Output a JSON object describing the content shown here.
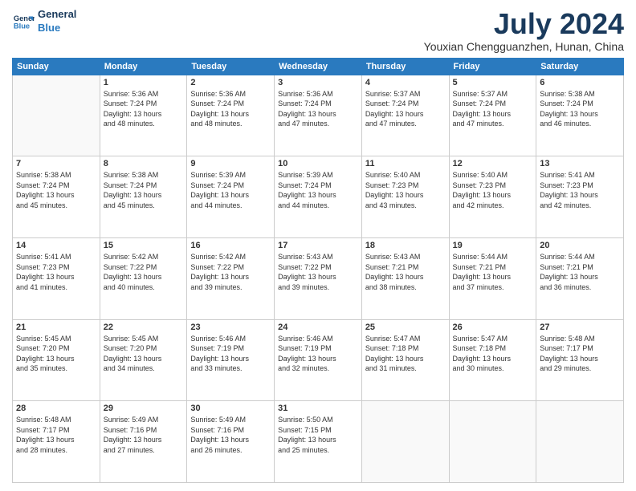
{
  "header": {
    "logo_line1": "General",
    "logo_line2": "Blue",
    "title": "July 2024",
    "subtitle": "Youxian Chengguanzhen, Hunan, China"
  },
  "days_of_week": [
    "Sunday",
    "Monday",
    "Tuesday",
    "Wednesday",
    "Thursday",
    "Friday",
    "Saturday"
  ],
  "weeks": [
    [
      {
        "day": "",
        "info": ""
      },
      {
        "day": "1",
        "info": "Sunrise: 5:36 AM\nSunset: 7:24 PM\nDaylight: 13 hours\nand 48 minutes."
      },
      {
        "day": "2",
        "info": "Sunrise: 5:36 AM\nSunset: 7:24 PM\nDaylight: 13 hours\nand 48 minutes."
      },
      {
        "day": "3",
        "info": "Sunrise: 5:36 AM\nSunset: 7:24 PM\nDaylight: 13 hours\nand 47 minutes."
      },
      {
        "day": "4",
        "info": "Sunrise: 5:37 AM\nSunset: 7:24 PM\nDaylight: 13 hours\nand 47 minutes."
      },
      {
        "day": "5",
        "info": "Sunrise: 5:37 AM\nSunset: 7:24 PM\nDaylight: 13 hours\nand 47 minutes."
      },
      {
        "day": "6",
        "info": "Sunrise: 5:38 AM\nSunset: 7:24 PM\nDaylight: 13 hours\nand 46 minutes."
      }
    ],
    [
      {
        "day": "7",
        "info": "Sunrise: 5:38 AM\nSunset: 7:24 PM\nDaylight: 13 hours\nand 45 minutes."
      },
      {
        "day": "8",
        "info": "Sunrise: 5:38 AM\nSunset: 7:24 PM\nDaylight: 13 hours\nand 45 minutes."
      },
      {
        "day": "9",
        "info": "Sunrise: 5:39 AM\nSunset: 7:24 PM\nDaylight: 13 hours\nand 44 minutes."
      },
      {
        "day": "10",
        "info": "Sunrise: 5:39 AM\nSunset: 7:24 PM\nDaylight: 13 hours\nand 44 minutes."
      },
      {
        "day": "11",
        "info": "Sunrise: 5:40 AM\nSunset: 7:23 PM\nDaylight: 13 hours\nand 43 minutes."
      },
      {
        "day": "12",
        "info": "Sunrise: 5:40 AM\nSunset: 7:23 PM\nDaylight: 13 hours\nand 42 minutes."
      },
      {
        "day": "13",
        "info": "Sunrise: 5:41 AM\nSunset: 7:23 PM\nDaylight: 13 hours\nand 42 minutes."
      }
    ],
    [
      {
        "day": "14",
        "info": "Sunrise: 5:41 AM\nSunset: 7:23 PM\nDaylight: 13 hours\nand 41 minutes."
      },
      {
        "day": "15",
        "info": "Sunrise: 5:42 AM\nSunset: 7:22 PM\nDaylight: 13 hours\nand 40 minutes."
      },
      {
        "day": "16",
        "info": "Sunrise: 5:42 AM\nSunset: 7:22 PM\nDaylight: 13 hours\nand 39 minutes."
      },
      {
        "day": "17",
        "info": "Sunrise: 5:43 AM\nSunset: 7:22 PM\nDaylight: 13 hours\nand 39 minutes."
      },
      {
        "day": "18",
        "info": "Sunrise: 5:43 AM\nSunset: 7:21 PM\nDaylight: 13 hours\nand 38 minutes."
      },
      {
        "day": "19",
        "info": "Sunrise: 5:44 AM\nSunset: 7:21 PM\nDaylight: 13 hours\nand 37 minutes."
      },
      {
        "day": "20",
        "info": "Sunrise: 5:44 AM\nSunset: 7:21 PM\nDaylight: 13 hours\nand 36 minutes."
      }
    ],
    [
      {
        "day": "21",
        "info": "Sunrise: 5:45 AM\nSunset: 7:20 PM\nDaylight: 13 hours\nand 35 minutes."
      },
      {
        "day": "22",
        "info": "Sunrise: 5:45 AM\nSunset: 7:20 PM\nDaylight: 13 hours\nand 34 minutes."
      },
      {
        "day": "23",
        "info": "Sunrise: 5:46 AM\nSunset: 7:19 PM\nDaylight: 13 hours\nand 33 minutes."
      },
      {
        "day": "24",
        "info": "Sunrise: 5:46 AM\nSunset: 7:19 PM\nDaylight: 13 hours\nand 32 minutes."
      },
      {
        "day": "25",
        "info": "Sunrise: 5:47 AM\nSunset: 7:18 PM\nDaylight: 13 hours\nand 31 minutes."
      },
      {
        "day": "26",
        "info": "Sunrise: 5:47 AM\nSunset: 7:18 PM\nDaylight: 13 hours\nand 30 minutes."
      },
      {
        "day": "27",
        "info": "Sunrise: 5:48 AM\nSunset: 7:17 PM\nDaylight: 13 hours\nand 29 minutes."
      }
    ],
    [
      {
        "day": "28",
        "info": "Sunrise: 5:48 AM\nSunset: 7:17 PM\nDaylight: 13 hours\nand 28 minutes."
      },
      {
        "day": "29",
        "info": "Sunrise: 5:49 AM\nSunset: 7:16 PM\nDaylight: 13 hours\nand 27 minutes."
      },
      {
        "day": "30",
        "info": "Sunrise: 5:49 AM\nSunset: 7:16 PM\nDaylight: 13 hours\nand 26 minutes."
      },
      {
        "day": "31",
        "info": "Sunrise: 5:50 AM\nSunset: 7:15 PM\nDaylight: 13 hours\nand 25 minutes."
      },
      {
        "day": "",
        "info": ""
      },
      {
        "day": "",
        "info": ""
      },
      {
        "day": "",
        "info": ""
      }
    ]
  ]
}
